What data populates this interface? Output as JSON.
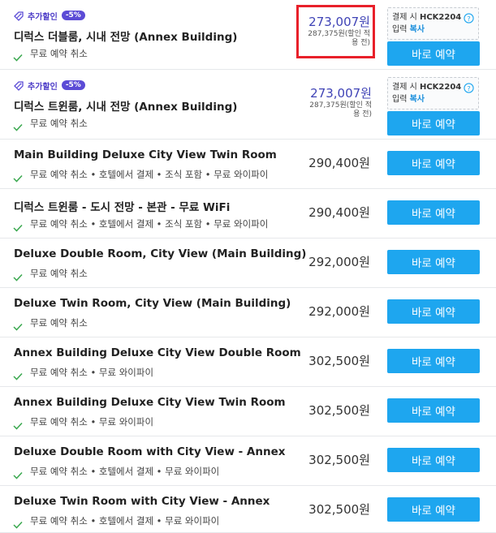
{
  "rooms": [
    {
      "badge_label": "추가할인",
      "badge_pct": "-5%",
      "name": "디럭스 더블룸, 시내 전망 (Annex Building)",
      "features": "무료 예약 취소",
      "price": "273,007원",
      "price_sub_1": "287,375원(할인 적",
      "price_sub_2": "용 전)",
      "coupon_prefix": "결제 시 ",
      "coupon_code": "HCK2204",
      "coupon_input": "입력 ",
      "coupon_copy": "복사",
      "book_label": "바로 예약",
      "highlighted": true
    },
    {
      "badge_label": "추가할인",
      "badge_pct": "-5%",
      "name": "디럭스 트윈룸, 시내 전망 (Annex Building)",
      "features": "무료 예약 취소",
      "price": "273,007원",
      "price_sub_1": "287,375원(할인 적",
      "price_sub_2": "용 전)",
      "coupon_prefix": "결제 시 ",
      "coupon_code": "HCK2204",
      "coupon_input": "입력 ",
      "coupon_copy": "복사",
      "book_label": "바로 예약",
      "highlighted": false
    },
    {
      "name": "Main Building Deluxe City View Twin Room",
      "features": "무료 예약 취소 • 호텔에서 결제 • 조식 포함 • 무료 와이파이",
      "price": "290,400원",
      "book_label": "바로 예약"
    },
    {
      "name": "디럭스 트윈룸 - 도시 전망 - 본관 - 무료 WiFi",
      "features": "무료 예약 취소 • 호텔에서 결제 • 조식 포함 • 무료 와이파이",
      "price": "290,400원",
      "book_label": "바로 예약"
    },
    {
      "name": "Deluxe Double Room, City View (Main Building)",
      "features": "무료 예약 취소",
      "price": "292,000원",
      "book_label": "바로 예약"
    },
    {
      "name": "Deluxe Twin Room, City View (Main Building)",
      "features": "무료 예약 취소",
      "price": "292,000원",
      "book_label": "바로 예약"
    },
    {
      "name": "Annex Building Deluxe City View Double Room",
      "features": "무료 예약 취소 • 무료 와이파이",
      "price": "302,500원",
      "book_label": "바로 예약"
    },
    {
      "name": "Annex Building Deluxe City View Twin Room",
      "features": "무료 예약 취소 • 무료 와이파이",
      "price": "302,500원",
      "book_label": "바로 예약"
    },
    {
      "name": "Deluxe Double Room with City View - Annex",
      "features": "무료 예약 취소 • 호텔에서 결제 • 무료 와이파이",
      "price": "302,500원",
      "book_label": "바로 예약"
    },
    {
      "name": "Deluxe Twin Room with City View - Annex",
      "features": "무료 예약 취소 • 호텔에서 결제 • 무료 와이파이",
      "price": "302,500원",
      "book_label": "바로 예약"
    }
  ],
  "colors": {
    "accent": "#1ea6ef",
    "discount": "#3f43b6",
    "badge": "#5b4bd6",
    "check": "#3aa84f",
    "highlight": "#e8202a"
  }
}
